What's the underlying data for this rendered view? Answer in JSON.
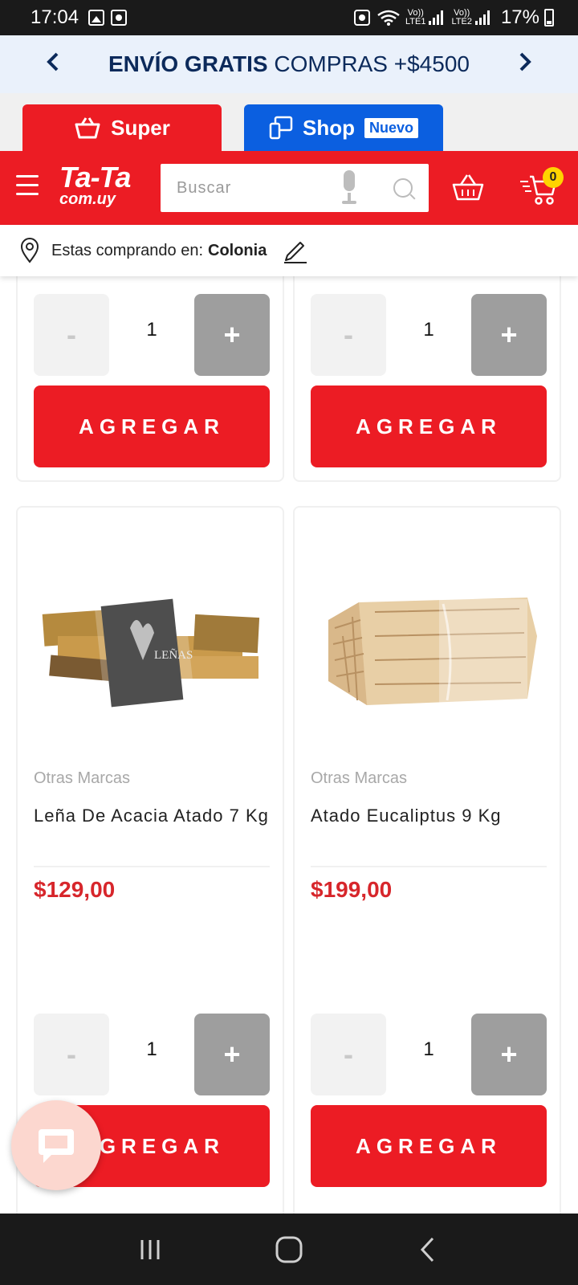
{
  "status_bar": {
    "time": "17:04",
    "sim1": "LTE1",
    "sim2": "LTE2",
    "volte": "Vo))",
    "battery": "17%"
  },
  "promo": {
    "bold": "ENVÍO GRATIS",
    "rest": "COMPRAS +$4500",
    "prev_icon": "chevron-left-icon",
    "next_icon": "chevron-right-icon"
  },
  "store_tabs": {
    "super_label": "Super",
    "shop_label": "Shop",
    "shop_badge": "Nuevo"
  },
  "header": {
    "logo_top": "Ta-Ta",
    "logo_bottom": "com.uy",
    "search_placeholder": "Buscar",
    "cart_count": "0"
  },
  "location": {
    "prefix": "Estas comprando en:",
    "city": "Colonia"
  },
  "products_top": [
    {
      "qty": "1",
      "minus": "-",
      "plus": "+",
      "add_label": "AGREGAR"
    },
    {
      "qty": "1",
      "minus": "-",
      "plus": "+",
      "add_label": "AGREGAR"
    }
  ],
  "products": [
    {
      "brand": "Otras Marcas",
      "name": "Leña De Acacia Atado 7 Kg",
      "price": "$129,00",
      "qty": "1",
      "minus": "-",
      "plus": "+",
      "add_label": "AGREGAR",
      "image_label": "LEÑAS"
    },
    {
      "brand": "Otras Marcas",
      "name": "Atado Eucaliptus 9 Kg",
      "price": "$199,00",
      "qty": "1",
      "minus": "-",
      "plus": "+",
      "add_label": "AGREGAR"
    }
  ],
  "colors": {
    "brand_red": "#ec1c24",
    "shop_blue": "#0b5fe0",
    "price_red": "#d7262b",
    "promo_navy": "#0c2a5b"
  }
}
